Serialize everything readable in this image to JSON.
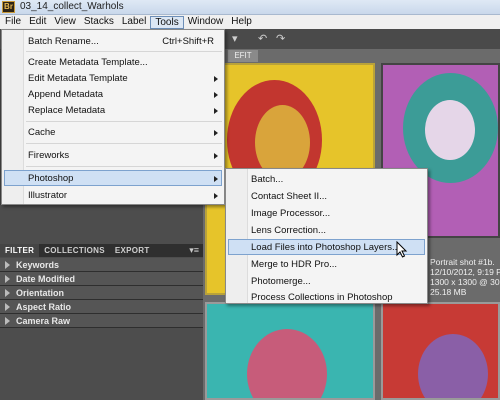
{
  "window": {
    "title": "03_14_collect_Warhols",
    "app_icon": "Br"
  },
  "menubar": [
    "File",
    "Edit",
    "View",
    "Stacks",
    "Label",
    "Tools",
    "Window",
    "Help"
  ],
  "tab_label": "EFIT",
  "tools_menu": {
    "batch_rename": "Batch Rename...",
    "batch_rename_shortcut": "Ctrl+Shift+R",
    "create_metadata_template": "Create Metadata Template...",
    "edit_metadata_template": "Edit Metadata Template",
    "append_metadata": "Append Metadata",
    "replace_metadata": "Replace Metadata",
    "cache": "Cache",
    "fireworks": "Fireworks",
    "photoshop": "Photoshop",
    "illustrator": "Illustrator"
  },
  "photoshop_submenu": [
    "Batch...",
    "Contact Sheet II...",
    "Image Processor...",
    "Lens Correction...",
    "Load Files into Photoshop Layers...",
    "Merge to HDR Pro...",
    "Photomerge...",
    "Process Collections in Photoshop"
  ],
  "panel_tabs": [
    "FILTER",
    "COLLECTIONS",
    "EXPORT"
  ],
  "filters": [
    "Keywords",
    "Date Modified",
    "Orientation",
    "Aspect Ratio",
    "Camera Raw"
  ],
  "thumbnail_meta": {
    "name": "Portrait shot #1b.",
    "date": "12/10/2012, 9:19 P",
    "dims": "1300 x 1300 @ 30",
    "size": "25.18 MB"
  },
  "colors": {
    "menu_highlight": "#cfe0f4",
    "panel_bg": "#4d4d4d"
  }
}
